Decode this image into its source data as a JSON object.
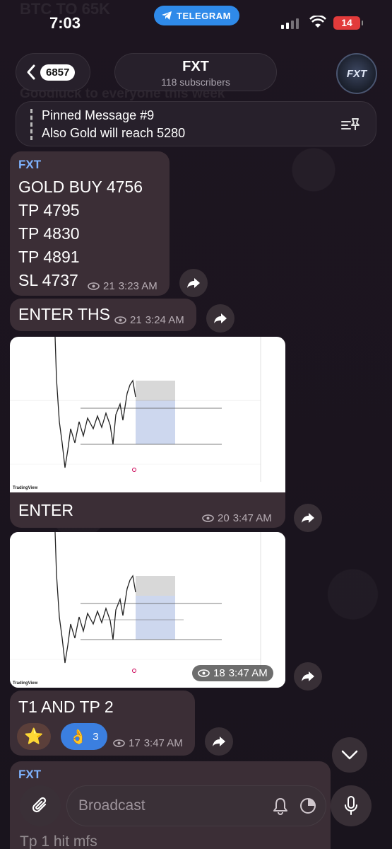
{
  "status_bar": {
    "time": "7:03",
    "telegram_label": "TELEGRAM",
    "battery": "14",
    "accent": "#2f8ae9",
    "battery_color": "#e23b3b"
  },
  "background": {
    "ghost_top": "BTC TO 65K",
    "ghost_mid": "Goodluck to everyone this week"
  },
  "header": {
    "back_count": "6857",
    "channel_name": "FXT",
    "subscribers": "118 subscribers",
    "avatar_text": "FXT"
  },
  "pinned": {
    "title": "Pinned Message #9",
    "text": "Also Gold will reach 5280",
    "icon": "unpin-icon"
  },
  "messages": [
    {
      "sender": "FXT",
      "lines": [
        "GOLD BUY 4756",
        "TP 4795",
        "TP 4830",
        "TP 4891",
        "SL 4737"
      ],
      "views": "21",
      "time": "3:23 AM"
    },
    {
      "text": "ENTER THS",
      "views": "21",
      "time": "3:24 AM"
    },
    {
      "image": "TradingView chart",
      "text": "ENTER",
      "views": "20",
      "time": "3:47 AM"
    },
    {
      "image": "TradingView chart",
      "views": "18",
      "time": "3:47 AM"
    },
    {
      "text": "T1 AND TP 2",
      "reactions": [
        {
          "emoji": "⭐",
          "count": ""
        },
        {
          "emoji": "👌",
          "count": "3"
        }
      ],
      "views": "17",
      "time": "3:47 AM"
    },
    {
      "sender": "FXT",
      "text": "Tp 1 hit mfs"
    }
  ],
  "chart_watermark": "TradingView",
  "composer": {
    "placeholder": "Broadcast",
    "icons": [
      "attach-icon",
      "bell-icon",
      "timer-icon",
      "mic-icon"
    ]
  }
}
